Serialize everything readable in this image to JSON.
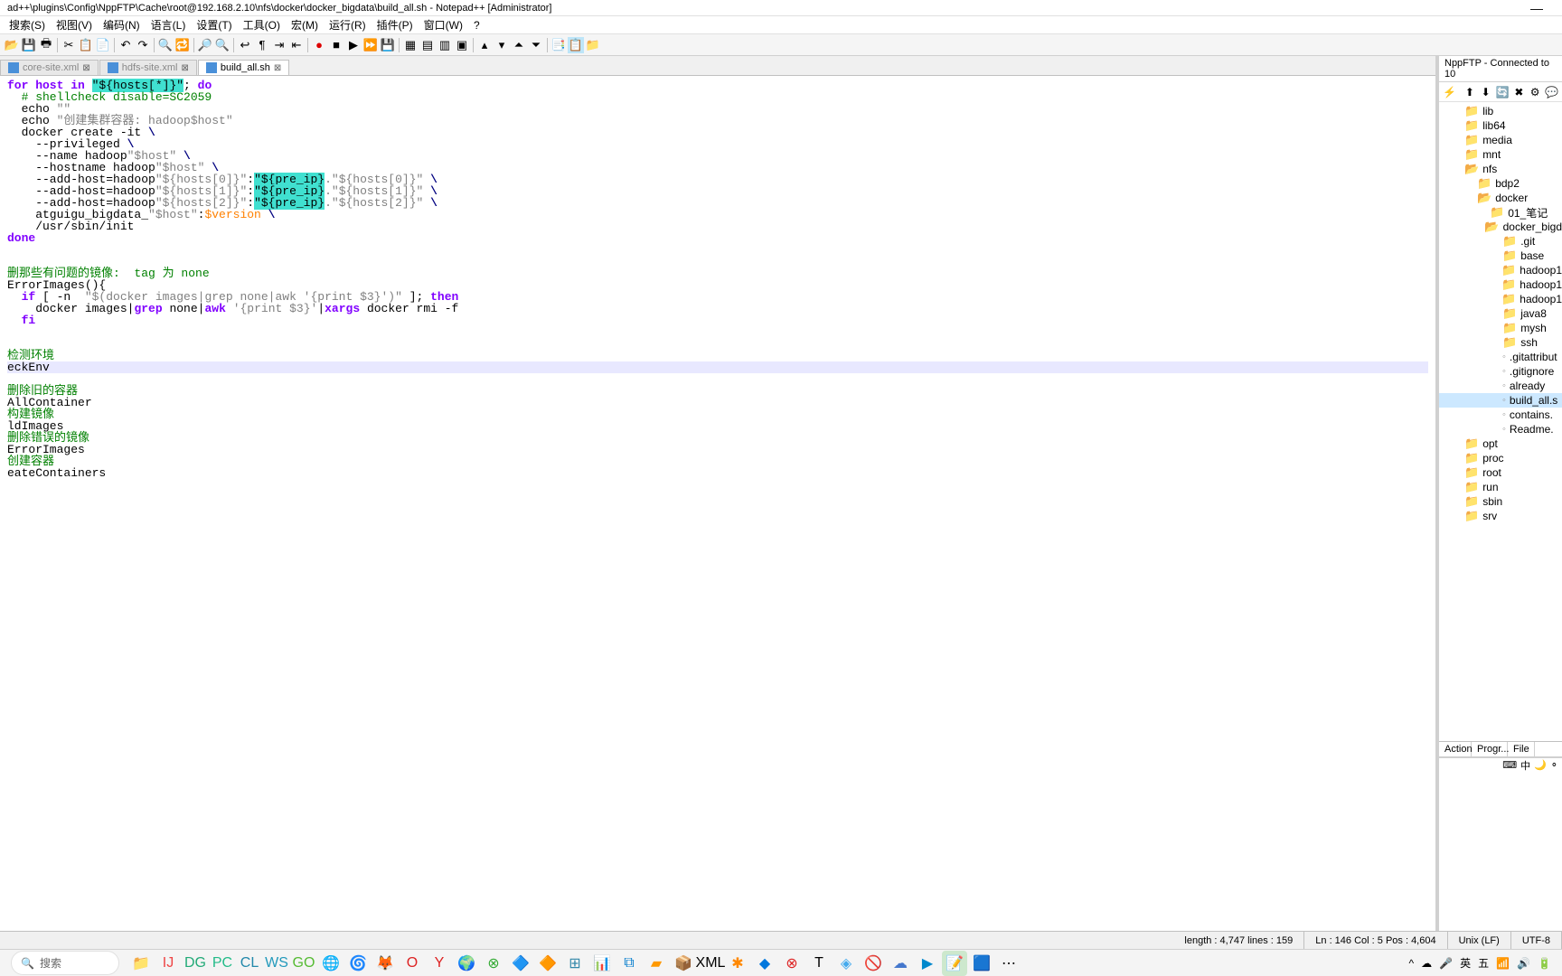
{
  "title": "ad++\\plugins\\Config\\NppFTP\\Cache\\root@192.168.2.10\\nfs\\docker\\docker_bigdata\\build_all.sh - Notepad++ [Administrator]",
  "menus": [
    "搜索(S)",
    "视图(V)",
    "编码(N)",
    "语言(L)",
    "设置(T)",
    "工具(O)",
    "宏(M)",
    "运行(R)",
    "插件(P)",
    "窗口(W)",
    "?"
  ],
  "tabs": [
    {
      "label": "core-site.xml",
      "dim": true,
      "close": "⊠"
    },
    {
      "label": "hdfs-site.xml",
      "dim": true,
      "close": "⊠"
    },
    {
      "label": "build_all.sh",
      "dim": false,
      "close": "⊠",
      "active": true
    }
  ],
  "code_lines": [
    {
      "t": "for host in ",
      "k": "kw",
      "rest": [
        {
          "t": "\"${hosts[*]}\"",
          "c": "hl"
        },
        {
          "t": "; ",
          "c": ""
        },
        {
          "t": "do",
          "c": "kw"
        }
      ]
    },
    {
      "plain": "  # shellcheck disable=SC2059",
      "c": "cmt"
    },
    {
      "seq": [
        {
          "t": "  echo ",
          "c": ""
        },
        {
          "t": "\"\"",
          "c": "str"
        }
      ]
    },
    {
      "seq": [
        {
          "t": "  echo ",
          "c": ""
        },
        {
          "t": "\"创建集群容器: hadoop$host\"",
          "c": "str"
        }
      ]
    },
    {
      "seq": [
        {
          "t": "  docker create -it ",
          "c": ""
        },
        {
          "t": "\\",
          "c": "op"
        }
      ]
    },
    {
      "seq": [
        {
          "t": "    --privileged ",
          "c": ""
        },
        {
          "t": "\\",
          "c": "op"
        }
      ]
    },
    {
      "seq": [
        {
          "t": "    --name hadoop",
          "c": ""
        },
        {
          "t": "\"$host\"",
          "c": "str"
        },
        {
          "t": " \\",
          "c": "op"
        }
      ]
    },
    {
      "seq": [
        {
          "t": "    --hostname hadoop",
          "c": ""
        },
        {
          "t": "\"$host\"",
          "c": "str"
        },
        {
          "t": " \\",
          "c": "op"
        }
      ]
    },
    {
      "seq": [
        {
          "t": "    --add-host=hadoop",
          "c": ""
        },
        {
          "t": "\"${hosts[0]}\"",
          "c": "str"
        },
        {
          "t": ":",
          "c": ""
        },
        {
          "t": "\"${pre_ip}",
          "c": "hl"
        },
        {
          "t": ".",
          "c": "str"
        },
        {
          "t": "\"${hosts[0]}\"",
          "c": "str"
        },
        {
          "t": " \\",
          "c": "op"
        }
      ]
    },
    {
      "seq": [
        {
          "t": "    --add-host=hadoop",
          "c": ""
        },
        {
          "t": "\"${hosts[1]}\"",
          "c": "str"
        },
        {
          "t": ":",
          "c": ""
        },
        {
          "t": "\"${pre_ip}",
          "c": "hl"
        },
        {
          "t": ".",
          "c": "str"
        },
        {
          "t": "\"${hosts[1]}\"",
          "c": "str"
        },
        {
          "t": " \\",
          "c": "op"
        }
      ]
    },
    {
      "seq": [
        {
          "t": "    --add-host=hadoop",
          "c": ""
        },
        {
          "t": "\"${hosts[2]}\"",
          "c": "str"
        },
        {
          "t": ":",
          "c": ""
        },
        {
          "t": "\"${pre_ip}",
          "c": "hl"
        },
        {
          "t": ".",
          "c": "str"
        },
        {
          "t": "\"${hosts[2]}\"",
          "c": "str"
        },
        {
          "t": " \\",
          "c": "op"
        }
      ]
    },
    {
      "seq": [
        {
          "t": "    atguigu_bigdata_",
          "c": ""
        },
        {
          "t": "\"$host\"",
          "c": "str"
        },
        {
          "t": ":",
          "c": ""
        },
        {
          "t": "$version",
          "c": "num"
        },
        {
          "t": " \\",
          "c": "op"
        }
      ]
    },
    {
      "plain": "    /usr/sbin/init",
      "c": ""
    },
    {
      "plain": "done",
      "c": "kw"
    },
    {
      "plain": "",
      "c": ""
    },
    {
      "plain": "",
      "c": ""
    },
    {
      "plain": "删那些有问题的镜像:  tag 为 none",
      "c": "cmt"
    },
    {
      "plain": "ErrorImages(){",
      "c": ""
    },
    {
      "seq": [
        {
          "t": "  if",
          "c": "kw"
        },
        {
          "t": " [ -n  ",
          "c": ""
        },
        {
          "t": "\"$(docker images|grep none|awk '{print $3}')\"",
          "c": "str"
        },
        {
          "t": " ]; ",
          "c": ""
        },
        {
          "t": "then",
          "c": "kw"
        }
      ]
    },
    {
      "seq": [
        {
          "t": "    docker images|",
          "c": ""
        },
        {
          "t": "grep",
          "c": "kw"
        },
        {
          "t": " none|",
          "c": ""
        },
        {
          "t": "awk",
          "c": "kw"
        },
        {
          "t": " ",
          "c": ""
        },
        {
          "t": "'{print $3}'",
          "c": "str"
        },
        {
          "t": "|",
          "c": ""
        },
        {
          "t": "xargs",
          "c": "kw"
        },
        {
          "t": " docker rmi -f",
          "c": ""
        }
      ]
    },
    {
      "plain": "  fi",
      "c": "kw"
    },
    {
      "plain": "",
      "c": ""
    },
    {
      "plain": "",
      "c": ""
    },
    {
      "plain": "检测环境",
      "c": "cmt"
    },
    {
      "plain": "eckEnv",
      "c": "",
      "current": true
    },
    {
      "plain": "",
      "c": ""
    },
    {
      "plain": "删除旧的容器",
      "c": "cmt"
    },
    {
      "plain": "AllContainer",
      "c": ""
    },
    {
      "plain": "构建镜像",
      "c": "cmt"
    },
    {
      "plain": "ldImages",
      "c": ""
    },
    {
      "plain": "删除错误的镜像",
      "c": "cmt"
    },
    {
      "plain": "ErrorImages",
      "c": ""
    },
    {
      "plain": "创建容器",
      "c": "cmt"
    },
    {
      "plain": "eateContainers",
      "c": ""
    }
  ],
  "ftp": {
    "title": "NppFTP - Connected to 10",
    "tree": [
      {
        "indent": 20,
        "icon": "folder",
        "label": "lib"
      },
      {
        "indent": 20,
        "icon": "folder",
        "label": "lib64"
      },
      {
        "indent": 20,
        "icon": "folder",
        "label": "media"
      },
      {
        "indent": 20,
        "icon": "folder",
        "label": "mnt"
      },
      {
        "indent": 20,
        "icon": "folder-open",
        "label": "nfs"
      },
      {
        "indent": 34,
        "icon": "folder",
        "label": "bdp2"
      },
      {
        "indent": 34,
        "icon": "folder-open",
        "label": "docker"
      },
      {
        "indent": 48,
        "icon": "folder",
        "label": "01_笔记"
      },
      {
        "indent": 48,
        "icon": "folder-open",
        "label": "docker_bigd"
      },
      {
        "indent": 62,
        "icon": "folder",
        "label": ".git"
      },
      {
        "indent": 62,
        "icon": "folder",
        "label": "base"
      },
      {
        "indent": 62,
        "icon": "folder",
        "label": "hadoop1"
      },
      {
        "indent": 62,
        "icon": "folder",
        "label": "hadoop1"
      },
      {
        "indent": 62,
        "icon": "folder",
        "label": "hadoop1"
      },
      {
        "indent": 62,
        "icon": "folder",
        "label": "java8"
      },
      {
        "indent": 62,
        "icon": "folder",
        "label": "mysh"
      },
      {
        "indent": 62,
        "icon": "folder",
        "label": "ssh"
      },
      {
        "indent": 62,
        "icon": "file",
        "label": ".gitattribut"
      },
      {
        "indent": 62,
        "icon": "file",
        "label": ".gitignore"
      },
      {
        "indent": 62,
        "icon": "file",
        "label": "already"
      },
      {
        "indent": 62,
        "icon": "file",
        "label": "build_all.s",
        "selected": true
      },
      {
        "indent": 62,
        "icon": "file",
        "label": "contains."
      },
      {
        "indent": 62,
        "icon": "file",
        "label": "Readme."
      },
      {
        "indent": 20,
        "icon": "folder",
        "label": "opt"
      },
      {
        "indent": 20,
        "icon": "folder",
        "label": "proc"
      },
      {
        "indent": 20,
        "icon": "folder",
        "label": "root"
      },
      {
        "indent": 20,
        "icon": "folder",
        "label": "run"
      },
      {
        "indent": 20,
        "icon": "folder",
        "label": "sbin"
      },
      {
        "indent": 20,
        "icon": "folder",
        "label": "srv"
      }
    ],
    "log_cols": [
      "Action",
      "Progr...",
      "File"
    ],
    "indicators": [
      "⌨",
      "中",
      "🌙",
      "⚬"
    ]
  },
  "status": {
    "length": "length : 4,747    lines : 159",
    "pos": "Ln : 146    Col : 5    Pos : 4,604",
    "eol": "Unix (LF)",
    "enc": "UTF-8"
  },
  "taskbar": {
    "search": "搜索",
    "tray_more": "⋯",
    "tray_expand": "^"
  }
}
